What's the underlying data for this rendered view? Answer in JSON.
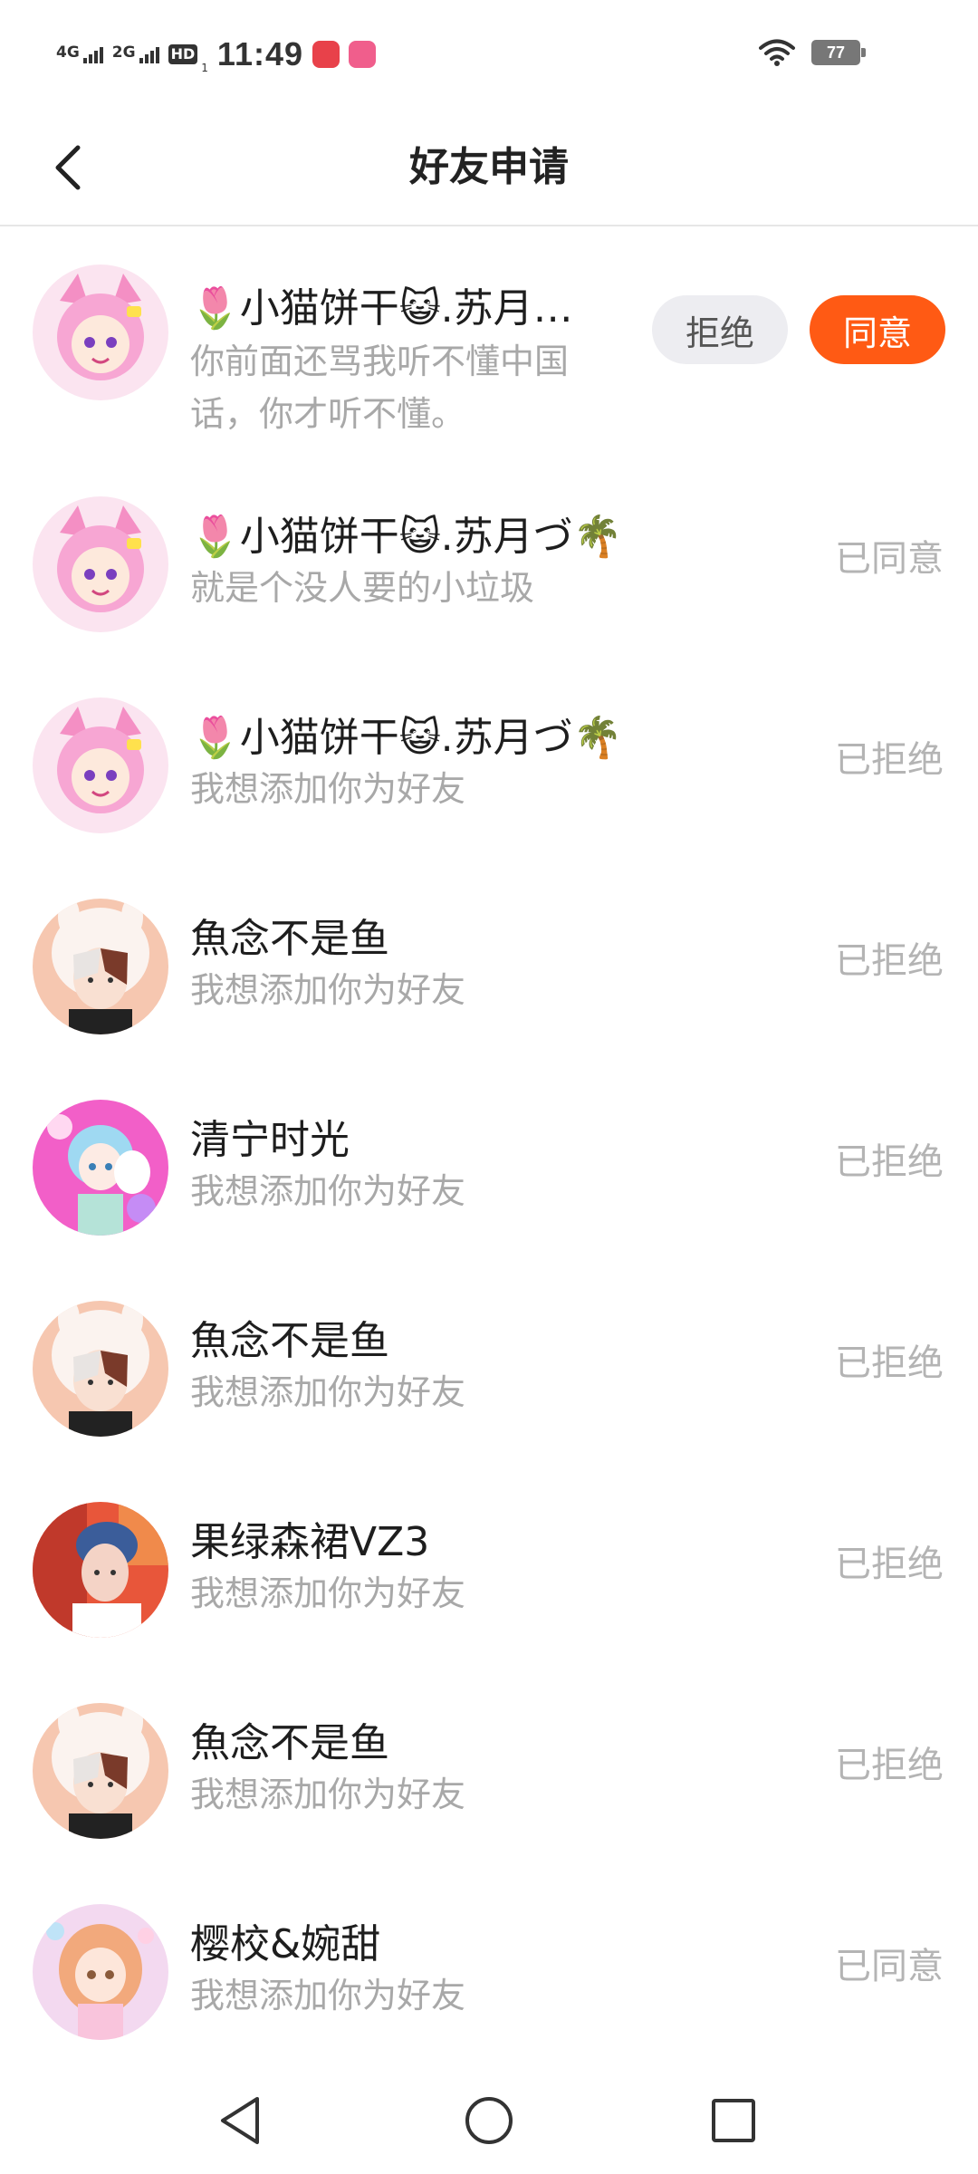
{
  "status_bar": {
    "network1": "4G",
    "network2": "2G",
    "hd_label": "HD",
    "hd_sub": "1",
    "time": "11:49",
    "battery": "77"
  },
  "header": {
    "title": "好友申请"
  },
  "requests": [
    {
      "name": "🌷小猫饼干😺.苏月…",
      "message": "你前面还骂我听不懂中国话，你才听不懂。",
      "status": "",
      "reject_label": "拒绝",
      "accept_label": "同意",
      "avatar": "pink-cat-girl"
    },
    {
      "name": "🌷小猫饼干😺.苏月づ🌴",
      "message": "就是个没人要的小垃圾",
      "status": "已同意",
      "avatar": "pink-cat-girl"
    },
    {
      "name": "🌷小猫饼干😺.苏月づ🌴",
      "message": "我想添加你为好友",
      "status": "已拒绝",
      "avatar": "pink-cat-girl"
    },
    {
      "name": "魚念不是鱼",
      "message": "我想添加你为好友",
      "status": "已拒绝",
      "avatar": "bunny-hood-boy"
    },
    {
      "name": "清宁时光",
      "message": "我想添加你为好友",
      "status": "已拒绝",
      "avatar": "blue-hair-girl"
    },
    {
      "name": "魚念不是鱼",
      "message": "我想添加你为好友",
      "status": "已拒绝",
      "avatar": "bunny-hood-boy"
    },
    {
      "name": "果绿森裙VZ3",
      "message": "我想添加你为好友",
      "status": "已拒绝",
      "avatar": "photo-boy"
    },
    {
      "name": "魚念不是鱼",
      "message": "我想添加你为好友",
      "status": "已拒绝",
      "avatar": "bunny-hood-boy"
    },
    {
      "name": "樱校&婉甜",
      "message": "我想添加你为好友",
      "status": "已同意",
      "avatar": "orange-hair-girl"
    }
  ],
  "colors": {
    "accent": "#ff5a14",
    "reject_bg": "#ededf1",
    "status_gray": "#b4b4b4"
  }
}
